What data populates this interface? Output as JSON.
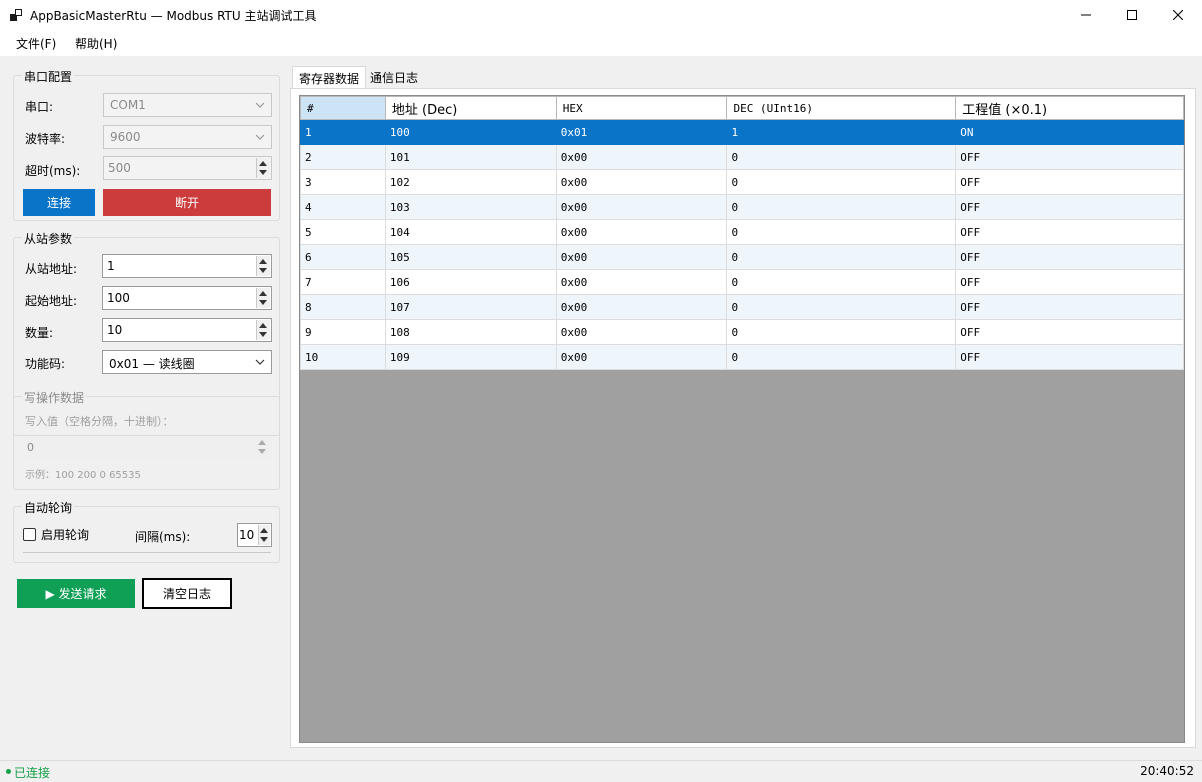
{
  "window": {
    "title": "AppBasicMasterRtu — Modbus RTU 主站调试工具",
    "icon": "app-window-icon"
  },
  "menu": [
    {
      "label": "文件(F)"
    },
    {
      "label": "帮助(H)"
    }
  ],
  "serial": {
    "title": "串口配置",
    "port_label": "串口:",
    "port_value": "COM1",
    "baud_label": "波特率:",
    "baud_value": "9600",
    "timeout_label": "超时(ms):",
    "timeout_value": "500",
    "connect_label": "连接",
    "disconnect_label": "断开",
    "colors": {
      "connect": "#0a74c9",
      "disconnect": "#cc3c3c"
    }
  },
  "slave": {
    "title": "从站参数",
    "address_label": "从站地址:",
    "address_value": "1",
    "start_label": "起始地址:",
    "start_value": "100",
    "count_label": "数量:",
    "count_value": "10",
    "func_label": "功能码:",
    "func_value": "0x01 — 读线圈"
  },
  "write": {
    "title": "写操作数据",
    "hint": "写入值（空格分隔，十进制）：",
    "value": "0",
    "example": "示例：100 200 0 65535"
  },
  "poll": {
    "title": "自动轮询",
    "enable_label": "启用轮询",
    "interval_label": "间隔(ms):",
    "interval_value": "10"
  },
  "actions": {
    "send_label": "▶ 发送请求",
    "clear_label": "清空日志",
    "send_color": "#0fa055"
  },
  "tabs": [
    {
      "label": "寄存器数据",
      "active": true
    },
    {
      "label": "通信日志",
      "active": false
    }
  ],
  "table": {
    "headers": [
      "#",
      "地址 (Dec)",
      "HEX",
      "DEC (UInt16)",
      "工程值 (×0.1)"
    ],
    "rows": [
      [
        "1",
        "100",
        "0x01",
        "1",
        "ON"
      ],
      [
        "2",
        "101",
        "0x00",
        "0",
        "OFF"
      ],
      [
        "3",
        "102",
        "0x00",
        "0",
        "OFF"
      ],
      [
        "4",
        "103",
        "0x00",
        "0",
        "OFF"
      ],
      [
        "5",
        "104",
        "0x00",
        "0",
        "OFF"
      ],
      [
        "6",
        "105",
        "0x00",
        "0",
        "OFF"
      ],
      [
        "7",
        "106",
        "0x00",
        "0",
        "OFF"
      ],
      [
        "8",
        "107",
        "0x00",
        "0",
        "OFF"
      ],
      [
        "9",
        "108",
        "0x00",
        "0",
        "OFF"
      ],
      [
        "10",
        "109",
        "0x00",
        "0",
        "OFF"
      ]
    ],
    "selected_row": 0,
    "selection_color": "#0a74c9"
  },
  "status": {
    "text": "已连接",
    "time": "20:40:52",
    "color": "#14a046"
  }
}
